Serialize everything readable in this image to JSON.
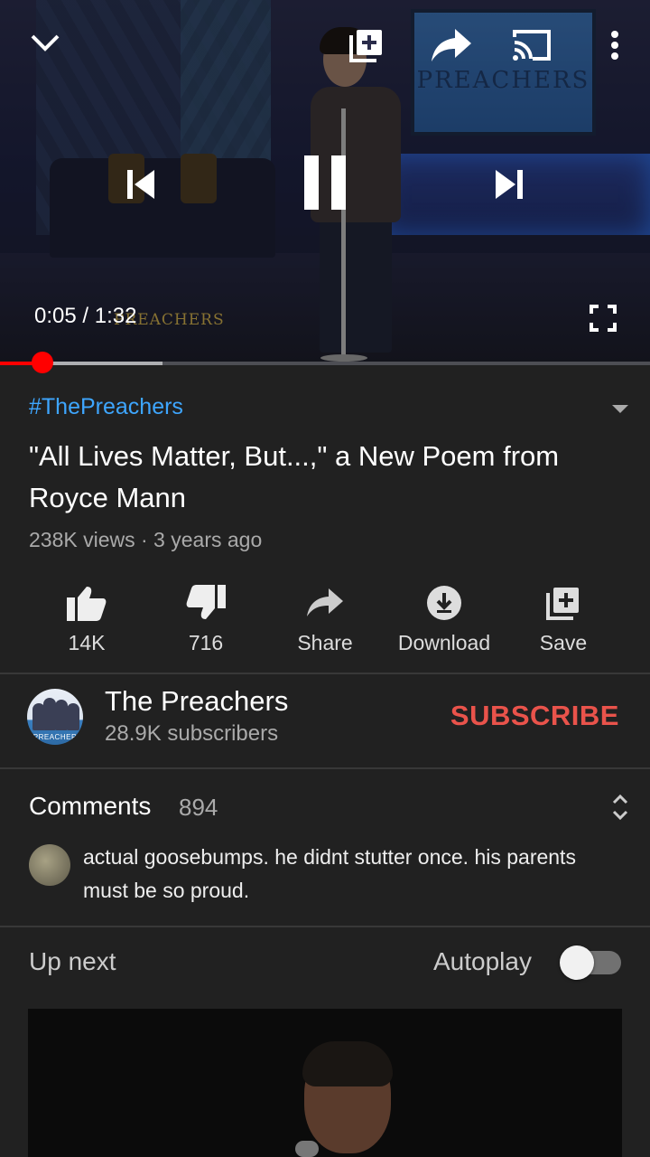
{
  "player": {
    "current_time": "0:05",
    "duration": "1:32",
    "time_display": "0:05 / 1:32",
    "progress_played": 0.065,
    "progress_buffered": 0.25,
    "screen_text": "PREACHERS",
    "logo_text": "PREACHERS",
    "icons": [
      "chevron-down-icon",
      "add-to-playlist-icon",
      "share-icon",
      "cast-icon",
      "more-vert-icon",
      "previous-icon",
      "pause-icon",
      "next-icon",
      "fullscreen-icon"
    ]
  },
  "video": {
    "hashtag": "#ThePreachers",
    "title": "\"All Lives Matter, But...,\" a New Poem from Royce Mann",
    "meta": "238K views · 3 years ago"
  },
  "actions": {
    "like": "14K",
    "dislike": "716",
    "share": "Share",
    "download": "Download",
    "save": "Save"
  },
  "channel": {
    "name": "The Preachers",
    "subscribers": "28.9K subscribers",
    "subscribe_label": "SUBSCRIBE",
    "avatar_text": "PREACHER"
  },
  "comments": {
    "title": "Comments",
    "count": "894",
    "top_comment": "actual goosebumps. he didnt stutter once. his parents must be so proud."
  },
  "up_next": {
    "label": "Up next",
    "autoplay_label": "Autoplay",
    "autoplay_on": false
  },
  "colors": {
    "background": "#212121",
    "accent_red": "#ff0000",
    "subscribe": "#e9534b",
    "link_blue": "#3ea6ff"
  }
}
